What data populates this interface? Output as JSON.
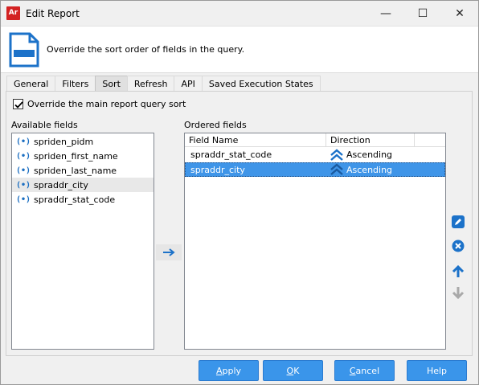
{
  "window": {
    "app_icon_text": "Ar",
    "title": "Edit Report",
    "controls": {
      "minimize": "—",
      "maximize": "☐",
      "close": "✕"
    }
  },
  "header": {
    "icon": "report-document-icon",
    "description": "Override the sort order of fields in the query."
  },
  "tabs": [
    {
      "label": "General",
      "active": false
    },
    {
      "label": "Filters",
      "active": false
    },
    {
      "label": "Sort",
      "active": true
    },
    {
      "label": "Refresh",
      "active": false
    },
    {
      "label": "API",
      "active": false
    },
    {
      "label": "Saved Execution States",
      "active": false
    }
  ],
  "sort": {
    "override_checkbox": {
      "label": "Override the main report query sort",
      "checked": true
    },
    "available_label": "Available fields",
    "available_fields": [
      {
        "name": "spriden_pidm",
        "selected": false
      },
      {
        "name": "spriden_first_name",
        "selected": false
      },
      {
        "name": "spriden_last_name",
        "selected": false
      },
      {
        "name": "spraddr_city",
        "selected": true
      },
      {
        "name": "spraddr_stat_code",
        "selected": false
      }
    ],
    "field_icon_glyph": "(•)",
    "ordered_label": "Ordered fields",
    "ordered_columns": [
      "Field Name",
      "Direction"
    ],
    "ordered_fields": [
      {
        "field": "spraddr_stat_code",
        "direction": "Ascending",
        "selected": false
      },
      {
        "field": "spraddr_city",
        "direction": "Ascending",
        "selected": true
      }
    ]
  },
  "side_tools": [
    "edit-icon",
    "remove-icon",
    "move-up-icon",
    "move-down-icon"
  ],
  "footer": {
    "apply": {
      "mnemonic": "A",
      "rest": "pply"
    },
    "ok": {
      "mnemonic": "O",
      "rest": "K"
    },
    "cancel": {
      "mnemonic": "C",
      "rest": "ancel"
    },
    "help": {
      "label": "Help"
    }
  },
  "colors": {
    "accent": "#3a95ea",
    "selection": "#3f95e8",
    "app_icon": "#d32222",
    "field_icon": "#1c6fc2"
  }
}
